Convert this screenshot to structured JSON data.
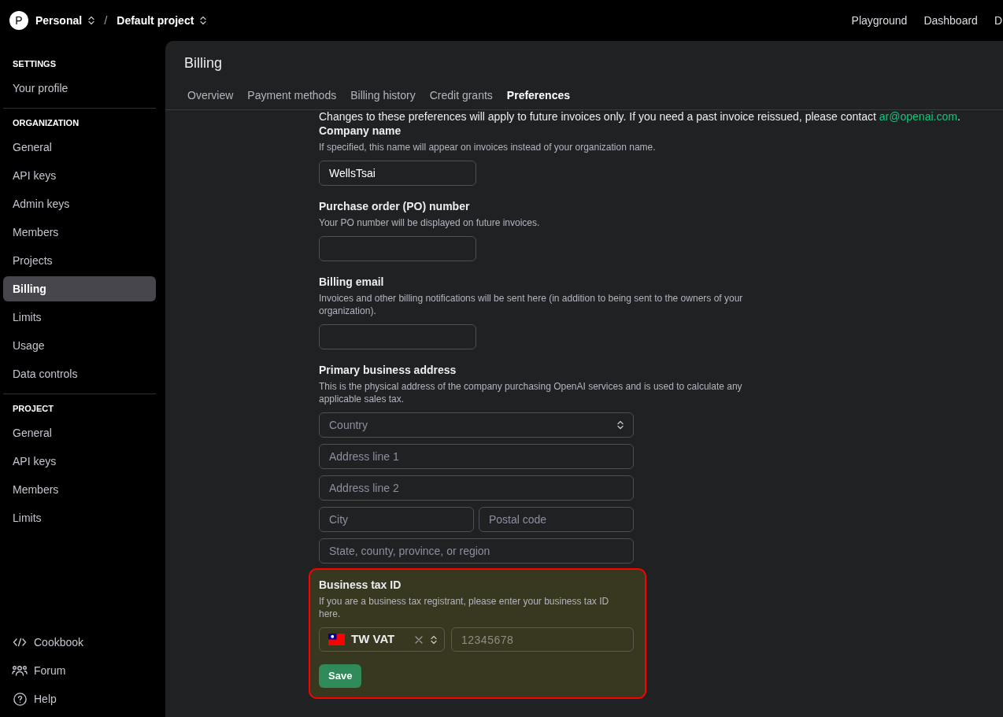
{
  "top_bar": {
    "avatar_letter": "P",
    "organization": "Personal",
    "separator": "/",
    "project": "Default project",
    "links": [
      "Playground",
      "Dashboard",
      "D"
    ]
  },
  "sidebar": {
    "sections": [
      {
        "heading": "SETTINGS",
        "items": [
          {
            "label": "Your profile",
            "selected": false
          }
        ]
      },
      {
        "heading": "ORGANIZATION",
        "items": [
          {
            "label": "General",
            "selected": false
          },
          {
            "label": "API keys",
            "selected": false
          },
          {
            "label": "Admin keys",
            "selected": false
          },
          {
            "label": "Members",
            "selected": false
          },
          {
            "label": "Projects",
            "selected": false
          },
          {
            "label": "Billing",
            "selected": true
          },
          {
            "label": "Limits",
            "selected": false
          },
          {
            "label": "Usage",
            "selected": false
          },
          {
            "label": "Data controls",
            "selected": false
          }
        ]
      },
      {
        "heading": "PROJECT",
        "items": [
          {
            "label": "General",
            "selected": false
          },
          {
            "label": "API keys",
            "selected": false
          },
          {
            "label": "Members",
            "selected": false
          },
          {
            "label": "Limits",
            "selected": false
          }
        ]
      }
    ],
    "footer_links": [
      {
        "label": "Cookbook",
        "kind": "code"
      },
      {
        "label": "Forum",
        "kind": "community"
      },
      {
        "label": "Help",
        "kind": "help"
      }
    ]
  },
  "page": {
    "title": "Billing",
    "tabs": [
      {
        "label": "Overview",
        "selected": false
      },
      {
        "label": "Payment methods",
        "selected": false
      },
      {
        "label": "Billing history",
        "selected": false
      },
      {
        "label": "Credit grants",
        "selected": false
      },
      {
        "label": "Preferences",
        "selected": true
      }
    ],
    "notice": {
      "text": "Changes to these preferences will apply to future invoices only. If you need a past invoice reissued, please contact ",
      "link": "ar@openai.com",
      "end": "."
    },
    "sections": [
      {
        "kind": "single",
        "label": "Company name",
        "description": "If specified, this name will appear on invoices instead of your organization name.",
        "highlighted": false,
        "value": "WellsTsai"
      },
      {
        "kind": "single",
        "label": "Purchase order (PO) number",
        "description": "Your PO number will be displayed on future invoices.",
        "highlighted": false
      },
      {
        "kind": "single",
        "label": "Billing email",
        "description": "Invoices and other billing notifications will be sent here (in addition to being sent to the owners of your organization).",
        "highlighted": false
      },
      {
        "kind": "address",
        "label": "Primary business address",
        "description": "This is the physical address of the company purchasing OpenAI services and is used to calculate any applicable sales tax.",
        "highlighted": false,
        "rows": [
          [
            {
              "kind": "select",
              "placeholder": "Country"
            }
          ],
          [
            {
              "kind": "input",
              "placeholder": "Address line 1"
            }
          ],
          [
            {
              "kind": "input",
              "placeholder": "Address line 2"
            }
          ],
          [
            {
              "kind": "input",
              "placeholder": "City"
            },
            {
              "kind": "input",
              "placeholder": "Postal code"
            }
          ],
          [
            {
              "kind": "input",
              "placeholder": "State, county, province, or region"
            }
          ]
        ]
      },
      {
        "kind": "tax_id",
        "label": "Business tax ID",
        "description": "If you are a business tax registrant, please enter your business tax ID here.",
        "highlighted": true,
        "tax_type": {
          "value": "TW VAT",
          "clearable": true
        },
        "tax_number": {
          "placeholder": "12345678"
        },
        "save_button": "Save"
      }
    ]
  }
}
